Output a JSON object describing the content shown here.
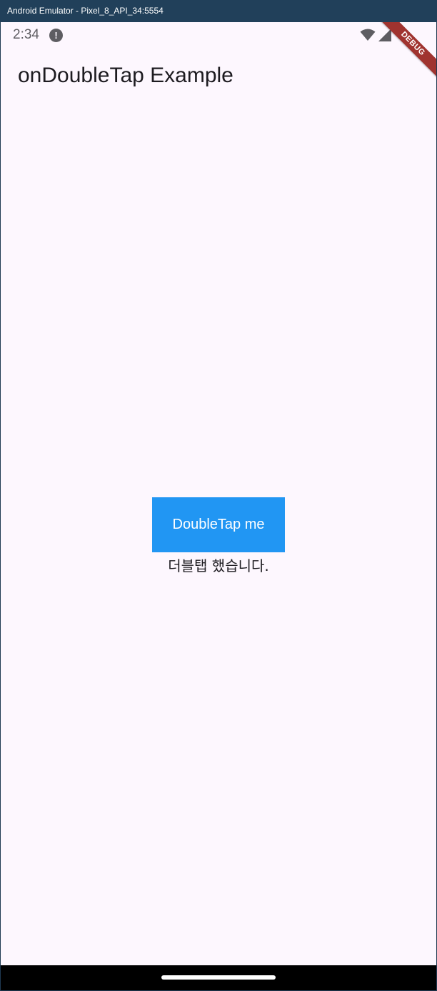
{
  "window": {
    "title": "Android Emulator - Pixel_8_API_34:5554"
  },
  "statusbar": {
    "time": "2:34",
    "alert_icon": "exclamation-circle-icon",
    "alert_glyph": "!",
    "wifi_icon": "wifi-icon",
    "signal_icon": "cellular-signal-icon"
  },
  "debug_banner": {
    "label": "DEBUG",
    "color": "#a0332f"
  },
  "appbar": {
    "title": "onDoubleTap Example"
  },
  "main": {
    "button_label": "DoubleTap me",
    "button_color": "#2196f3",
    "result_text": "더블탭 했습니다."
  },
  "colors": {
    "background": "#fdf7fe",
    "text": "#1d1b20"
  }
}
